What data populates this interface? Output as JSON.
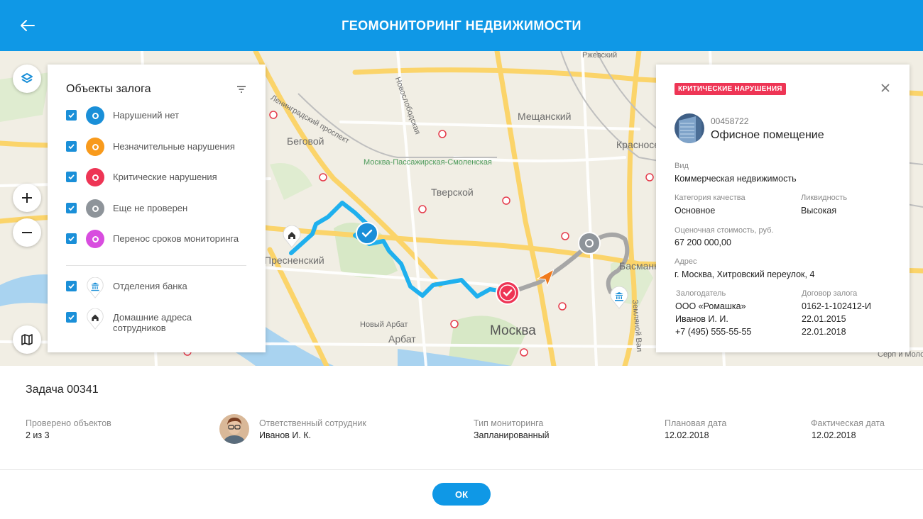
{
  "header": {
    "title": "ГЕОМОНИТОРИНГ НЕДВИЖИМОСТИ",
    "back_icon": "arrow-left-icon"
  },
  "map": {
    "labels": {
      "begovoy": "Беговой",
      "presnensky": "Пресненский",
      "tverskoy": "Тверской",
      "meshchansky": "Мещанский",
      "krasnoselsky": "Красносе",
      "basmanny": "Басманн",
      "arbat": "Арбат",
      "novy_arbat": "Новый Арбат",
      "moskva": "Москва",
      "mpsm": "Москва-Пассажирская-Смоленская",
      "leningradsky": "Ленинградский проспект",
      "novoslobodskaya": "Новослободская",
      "rzhevsky": "Ржевский",
      "serp_molot": "Серп и Молот",
      "zemlyanoy_val": "Земляной Вал"
    },
    "controls": {
      "layers_icon": "layers-icon",
      "zoom_in_icon": "plus-icon",
      "zoom_out_icon": "minus-icon",
      "map_type_icon": "map-icon"
    },
    "colors": {
      "route_blue": "#1fb0ee",
      "route_gray": "#a6a6a6",
      "critical": "#ee3555",
      "ok": "#1a8fd8",
      "pending": "#8e949a",
      "orange": "#f89a1c",
      "magenta": "#d84ddf"
    }
  },
  "legend": {
    "title": "Объекты залога",
    "filter_icon": "filter-icon",
    "items": [
      {
        "label": "Нарушений нет",
        "color": "#1a8fd8",
        "checked": true
      },
      {
        "label": "Незначительные нарушения",
        "color": "#f89a1c",
        "checked": true
      },
      {
        "label": "Критические нарушения",
        "color": "#ee3555",
        "checked": true
      },
      {
        "label": "Еще не проверен",
        "color": "#8e949a",
        "checked": true
      },
      {
        "label": "Перенос сроков мониторинга",
        "color": "#d84ddf",
        "checked": true
      }
    ],
    "pins": [
      {
        "label": "Отделения банка",
        "icon": "bank-icon",
        "checked": true
      },
      {
        "label": "Домашние адреса сотрудников",
        "icon": "home-icon",
        "checked": true
      }
    ]
  },
  "card": {
    "badge": "КРИТИЧЕСКИЕ НАРУШЕНИЯ",
    "close_icon": "close-icon",
    "id": "00458722",
    "name": "Офисное помещение",
    "type_label": "Вид",
    "type_value": "Коммерческая недвижимость",
    "quality_label": "Категория качества",
    "quality_value": "Основное",
    "liquidity_label": "Ликвидность",
    "liquidity_value": "Высокая",
    "cost_label": "Оценочная стоимость, руб.",
    "cost_value": "67 200 000,00",
    "address_label": "Адрес",
    "address_value": "г. Москва, Хитровский переулок, 4",
    "pledger_label": "Залогодатель",
    "pledger_company": "ООО «Ромашка»",
    "pledger_person": "Иванов И. И.",
    "pledger_phone": "+7 (495) 555-55-55",
    "contract_label": "Договор залога",
    "contract_number": "0162-1-102412-И",
    "contract_date1": "22.01.2015",
    "contract_date2": "22.01.2018"
  },
  "task": {
    "title": "Задача 00341",
    "checked_label": "Проверено объектов",
    "checked_value": "2 из 3",
    "employee_label": "Ответственный сотрудник",
    "employee_value": "Иванов И. К.",
    "type_label": "Тип мониторинга",
    "type_value": "Запланированный",
    "plan_label": "Плановая дата",
    "plan_value": "12.02.2018",
    "fact_label": "Фактическая дата",
    "fact_value": "12.02.2018"
  },
  "ok_button": "ОК"
}
